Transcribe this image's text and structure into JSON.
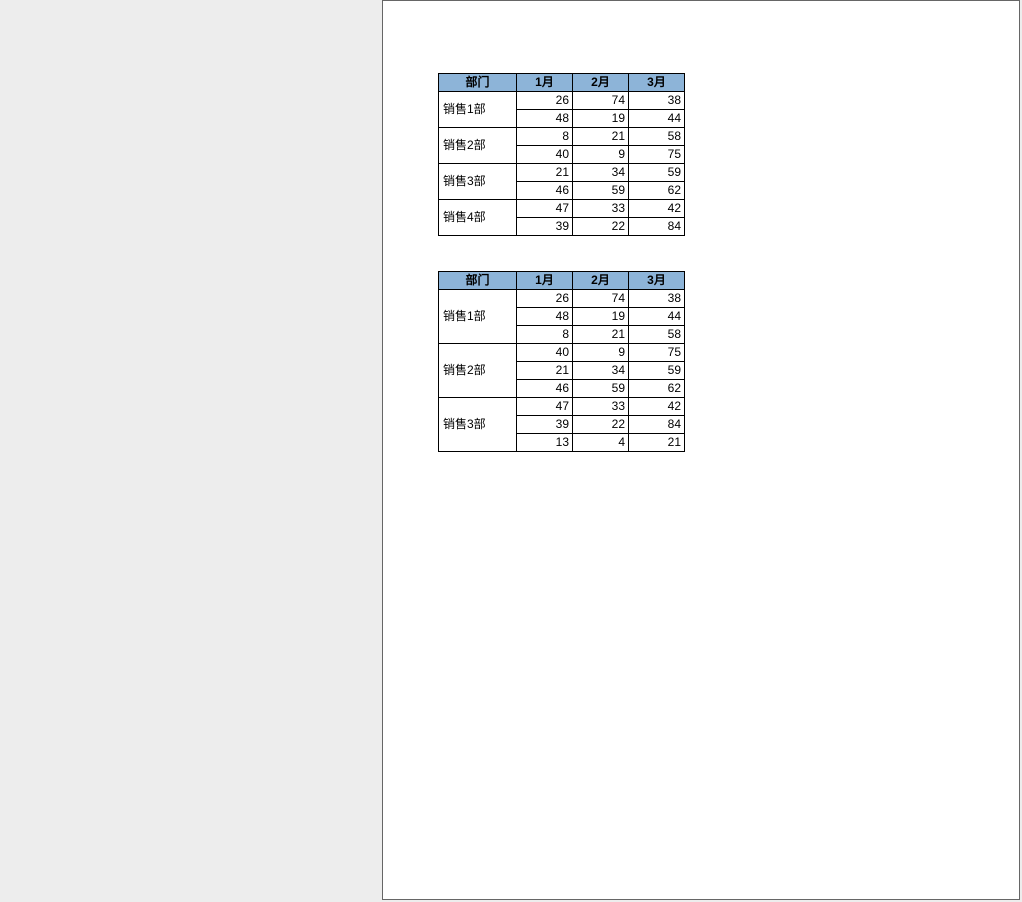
{
  "headers": {
    "dept": "部门",
    "m1": "1月",
    "m2": "2月",
    "m3": "3月"
  },
  "table1": {
    "groups": [
      {
        "dept": "销售1部",
        "rows": [
          {
            "m1": 26,
            "m2": 74,
            "m3": 38
          },
          {
            "m1": 48,
            "m2": 19,
            "m3": 44
          }
        ]
      },
      {
        "dept": "销售2部",
        "rows": [
          {
            "m1": 8,
            "m2": 21,
            "m3": 58
          },
          {
            "m1": 40,
            "m2": 9,
            "m3": 75
          }
        ]
      },
      {
        "dept": "销售3部",
        "rows": [
          {
            "m1": 21,
            "m2": 34,
            "m3": 59
          },
          {
            "m1": 46,
            "m2": 59,
            "m3": 62
          }
        ]
      },
      {
        "dept": "销售4部",
        "rows": [
          {
            "m1": 47,
            "m2": 33,
            "m3": 42
          },
          {
            "m1": 39,
            "m2": 22,
            "m3": 84
          }
        ]
      }
    ]
  },
  "table2": {
    "groups": [
      {
        "dept": "销售1部",
        "rows": [
          {
            "m1": 26,
            "m2": 74,
            "m3": 38
          },
          {
            "m1": 48,
            "m2": 19,
            "m3": 44
          },
          {
            "m1": 8,
            "m2": 21,
            "m3": 58
          }
        ]
      },
      {
        "dept": "销售2部",
        "rows": [
          {
            "m1": 40,
            "m2": 9,
            "m3": 75
          },
          {
            "m1": 21,
            "m2": 34,
            "m3": 59
          },
          {
            "m1": 46,
            "m2": 59,
            "m3": 62
          }
        ]
      },
      {
        "dept": "销售3部",
        "rows": [
          {
            "m1": 47,
            "m2": 33,
            "m3": 42
          },
          {
            "m1": 39,
            "m2": 22,
            "m3": 84
          },
          {
            "m1": 13,
            "m2": 4,
            "m3": 21
          }
        ]
      }
    ]
  }
}
